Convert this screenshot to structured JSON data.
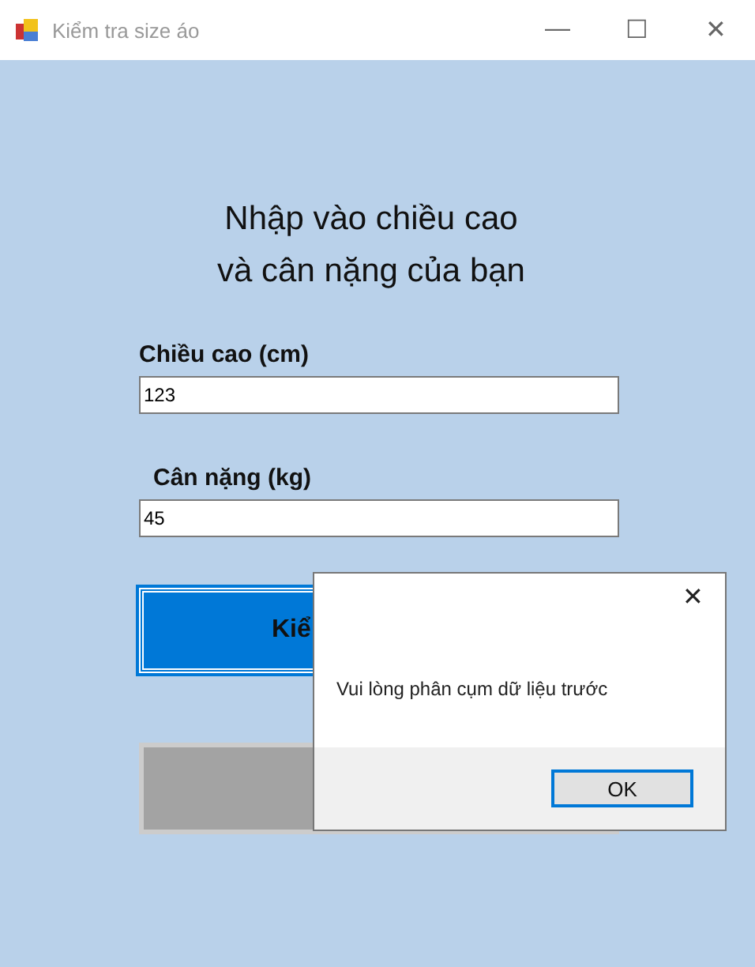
{
  "window": {
    "title": "Kiểm tra size áo",
    "controls": [
      "—",
      "☐",
      "✕"
    ]
  },
  "heading": [
    "Nhập vào chiều cao",
    "và cân nặng của bạn"
  ],
  "fields": [
    {
      "label": "Chiều cao (cm)",
      "value": "123"
    },
    {
      "label": "Cân nặng (kg)",
      "value": "45"
    }
  ],
  "buttons": [
    {
      "label": "Kiể",
      "kind": "primary"
    },
    {
      "kind": "disabled"
    }
  ],
  "dialog": {
    "close": "✕",
    "message": "Vui lòng phân cụm dữ liệu trước",
    "ok": "OK"
  }
}
